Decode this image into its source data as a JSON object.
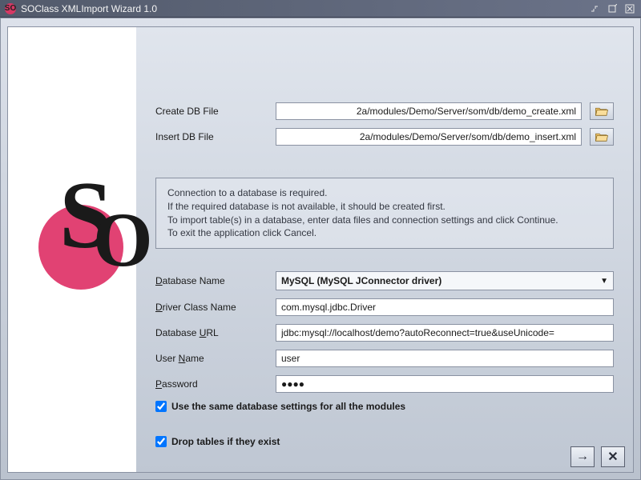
{
  "title": "SOClass XMLImport Wizard 1.0",
  "files": {
    "create_label": "Create DB File",
    "create_value": "2a/modules/Demo/Server/som/db/demo_create.xml",
    "insert_label": "Insert DB File",
    "insert_value": "2a/modules/Demo/Server/som/db/demo_insert.xml"
  },
  "info": {
    "line1": "Connection to a database is required.",
    "line2": "If the required database is not available, it should be created first.",
    "line3": "To import table(s) in a database, enter data files and connection settings and click Continue.",
    "line4": "To exit the application click Cancel."
  },
  "db": {
    "name_label_pre": "D",
    "name_label_rest": "atabase Name",
    "name_value": "MySQL (MySQL JConnector driver)",
    "driver_label_pre": "D",
    "driver_label_rest": "river Class Name",
    "driver_value": "com.mysql.jdbc.Driver",
    "url_label_pre": "Database ",
    "url_label_u": "U",
    "url_label_rest": "RL",
    "url_value": "jdbc:mysql://localhost/demo?autoReconnect=true&useUnicode=",
    "user_label_pre": "User ",
    "user_label_u": "N",
    "user_label_rest": "ame",
    "user_value": "user",
    "pass_label_u": "P",
    "pass_label_rest": "assword",
    "pass_value": "●●●●"
  },
  "checks": {
    "same_settings": "Use the same database settings for all the modules",
    "drop_tables": "Drop tables if they exist"
  }
}
